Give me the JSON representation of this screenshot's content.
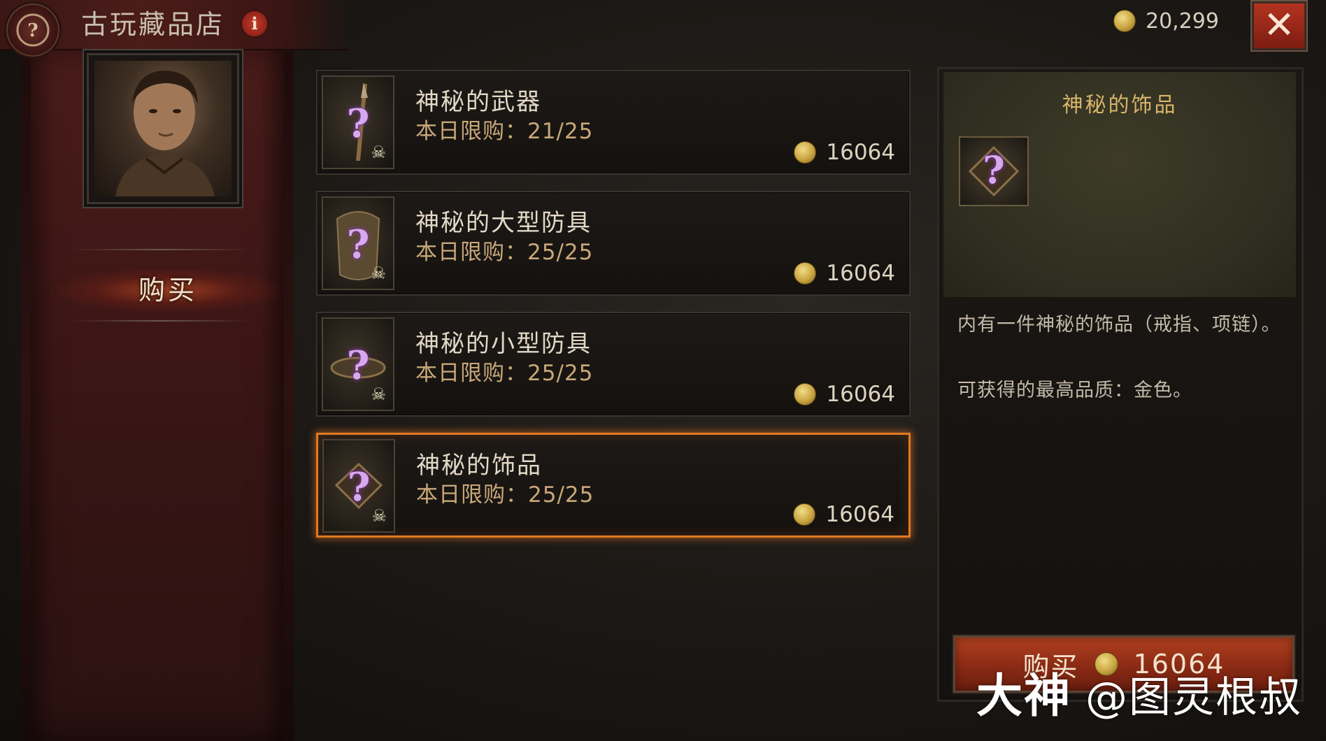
{
  "header": {
    "shop_title": "古玩藏品店",
    "info_icon": "i",
    "currency_amount": "20,299",
    "close_icon": "✕"
  },
  "sidebar": {
    "tab_buy_label": "购买"
  },
  "items": [
    {
      "name": "神秘的武器",
      "limit": "本日限购：21/25",
      "price": "16064",
      "icon": "mystery-weapon-icon"
    },
    {
      "name": "神秘的大型防具",
      "limit": "本日限购：25/25",
      "price": "16064",
      "icon": "mystery-large-armor-icon"
    },
    {
      "name": "神秘的小型防具",
      "limit": "本日限购：25/25",
      "price": "16064",
      "icon": "mystery-small-armor-icon"
    },
    {
      "name": "神秘的饰品",
      "limit": "本日限购：25/25",
      "price": "16064",
      "icon": "mystery-jewelry-icon"
    }
  ],
  "detail": {
    "title": "神秘的饰品",
    "description": "内有一件神秘的饰品（戒指、项链）。",
    "quality": "可获得的最高品质：金色。",
    "buy_label": "购买",
    "buy_price": "16064"
  },
  "watermark": {
    "brand": "大神",
    "handle": "@图灵根叔"
  },
  "colors": {
    "accent_orange": "#e07a22",
    "banner_red": "#3b1615",
    "detail_gold": "#d9b56a",
    "close_red": "#b2331f"
  }
}
